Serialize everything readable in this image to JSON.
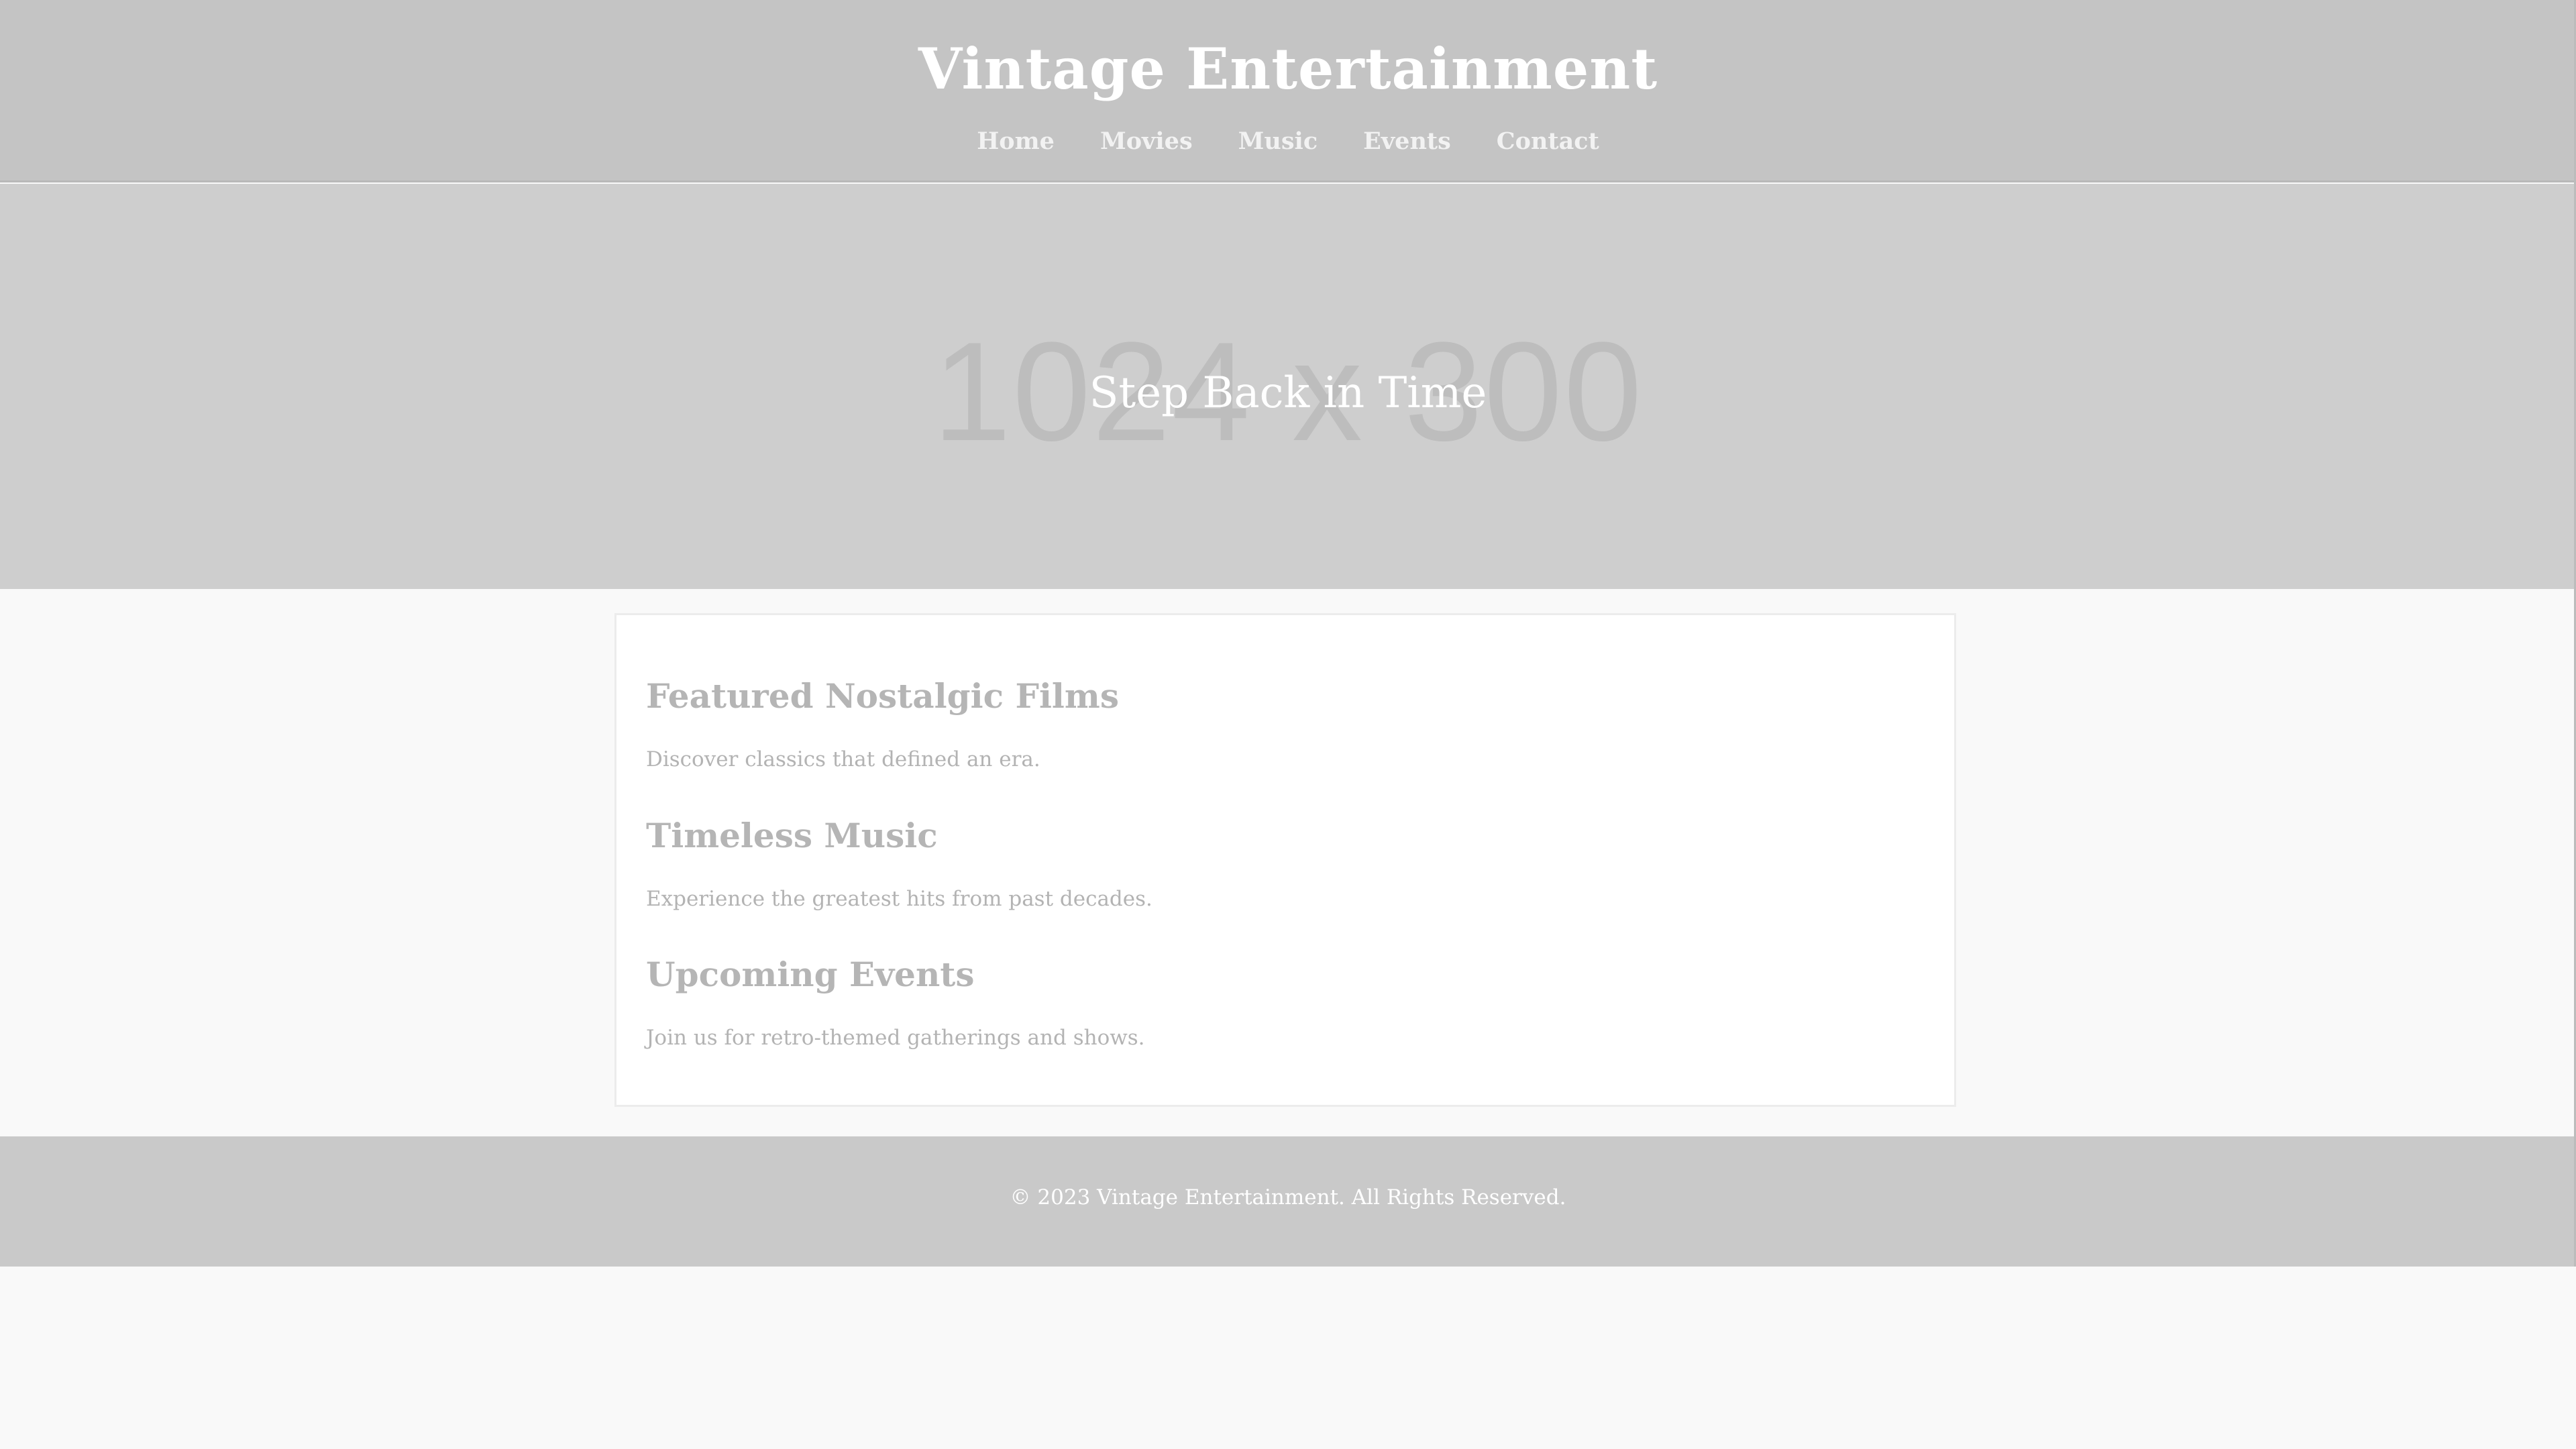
{
  "header": {
    "title": "Vintage Entertainment",
    "nav": [
      "Home",
      "Movies",
      "Music",
      "Events",
      "Contact"
    ]
  },
  "hero": {
    "placeholder_text": "1024 x 300",
    "title": "Step Back in Time"
  },
  "sections": [
    {
      "heading": "Featured Nostalgic Films",
      "text": "Discover classics that defined an era."
    },
    {
      "heading": "Timeless Music",
      "text": "Experience the greatest hits from past decades."
    },
    {
      "heading": "Upcoming Events",
      "text": "Join us for retro-themed gatherings and shows."
    }
  ],
  "footer": {
    "text": "© 2023 Vintage Entertainment. All Rights Reserved."
  }
}
